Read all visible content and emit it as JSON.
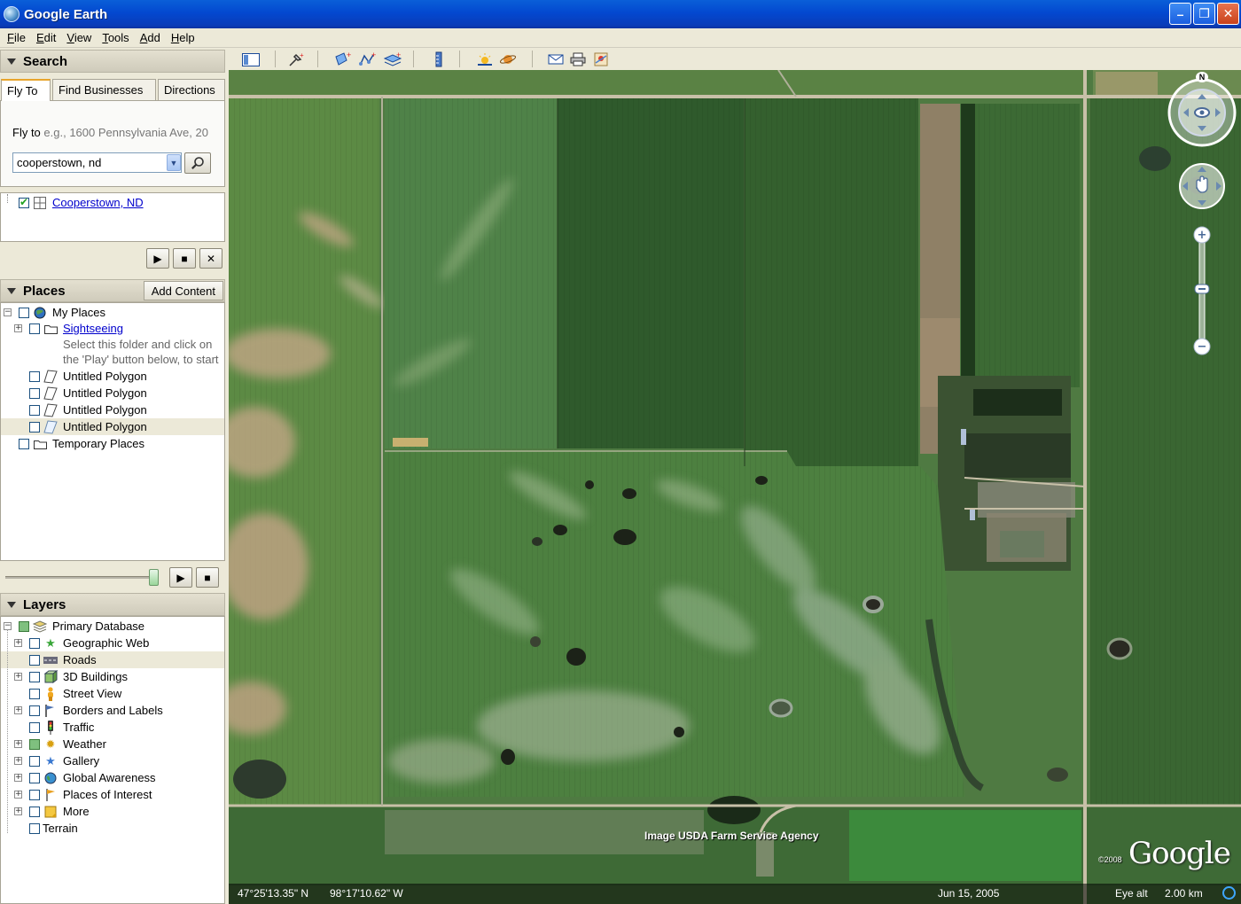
{
  "window": {
    "title": "Google Earth",
    "buttons": {
      "minimize": "–",
      "maximize": "❐",
      "close": "✕"
    }
  },
  "menu": [
    "File",
    "Edit",
    "View",
    "Tools",
    "Add",
    "Help"
  ],
  "search": {
    "header": "Search",
    "tabs": [
      "Fly To",
      "Find Businesses",
      "Directions"
    ],
    "fly_label": "Fly to",
    "fly_hint": "e.g., 1600 Pennsylvania Ave, 20",
    "input_value": "cooperstown, nd",
    "result": "Cooperstown, ND"
  },
  "places": {
    "header": "Places",
    "add_content": "Add Content",
    "items": [
      {
        "label": "My Places"
      },
      {
        "label": "Sightseeing",
        "description_1": "Select this folder and click on",
        "description_2": "the 'Play' button below, to start"
      },
      {
        "label": "Untitled Polygon"
      },
      {
        "label": "Untitled Polygon"
      },
      {
        "label": "Untitled Polygon"
      },
      {
        "label": "Untitled Polygon"
      },
      {
        "label": "Temporary Places"
      }
    ]
  },
  "layers": {
    "header": "Layers",
    "items": [
      {
        "label": "Primary Database"
      },
      {
        "label": "Geographic Web"
      },
      {
        "label": "Roads"
      },
      {
        "label": "3D Buildings"
      },
      {
        "label": "Street View"
      },
      {
        "label": "Borders and Labels"
      },
      {
        "label": "Traffic"
      },
      {
        "label": "Weather"
      },
      {
        "label": "Gallery"
      },
      {
        "label": "Global Awareness"
      },
      {
        "label": "Places of Interest"
      },
      {
        "label": "More"
      },
      {
        "label": "Terrain"
      }
    ]
  },
  "map": {
    "attribution": "Image USDA Farm Service Agency",
    "logo": "Google",
    "copyright": "©2008",
    "north": "N",
    "status": {
      "latitude": "47°25'13.35\" N",
      "longitude": "98°17'10.62\" W",
      "date": "Jun 15, 2005",
      "eye_alt_label": "Eye alt",
      "eye_alt_value": "2.00 km"
    }
  },
  "colors": {
    "titlebar": "#0348d0",
    "panel": "#ece9d8",
    "link": "#0000cc",
    "field_dark": "#2f5a2c",
    "field_light": "#5f8a4a"
  }
}
